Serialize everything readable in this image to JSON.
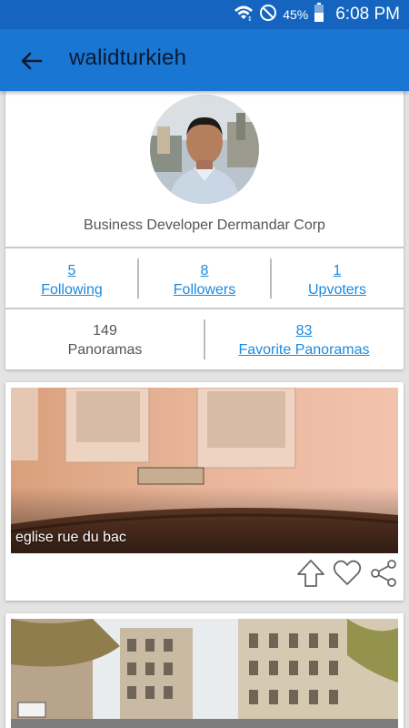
{
  "status_bar": {
    "battery_percent": "45%",
    "time": "6:08 PM",
    "icons": [
      "wifi-icon",
      "do-not-disturb-icon",
      "battery-icon"
    ]
  },
  "app_bar": {
    "title": "walidturkieh",
    "back_icon": "arrow-left-icon"
  },
  "profile": {
    "bio": "Business Developer Dermandar Corp",
    "stats": {
      "following": {
        "count": "5",
        "label": "Following"
      },
      "followers": {
        "count": "8",
        "label": "Followers"
      },
      "upvoters": {
        "count": "1",
        "label": "Upvoters"
      },
      "panoramas": {
        "count": "149",
        "label": "Panoramas"
      },
      "favorites": {
        "count": "83",
        "label": "Favorite Panoramas"
      }
    }
  },
  "panoramas": [
    {
      "caption": "eglise rue du bac",
      "actions": [
        "upvote-icon",
        "heart-icon",
        "share-icon"
      ]
    },
    {
      "caption": ""
    }
  ],
  "colors": {
    "status_bar": "#1565c0",
    "app_bar": "#1976d2",
    "link": "#1a8ae0"
  }
}
